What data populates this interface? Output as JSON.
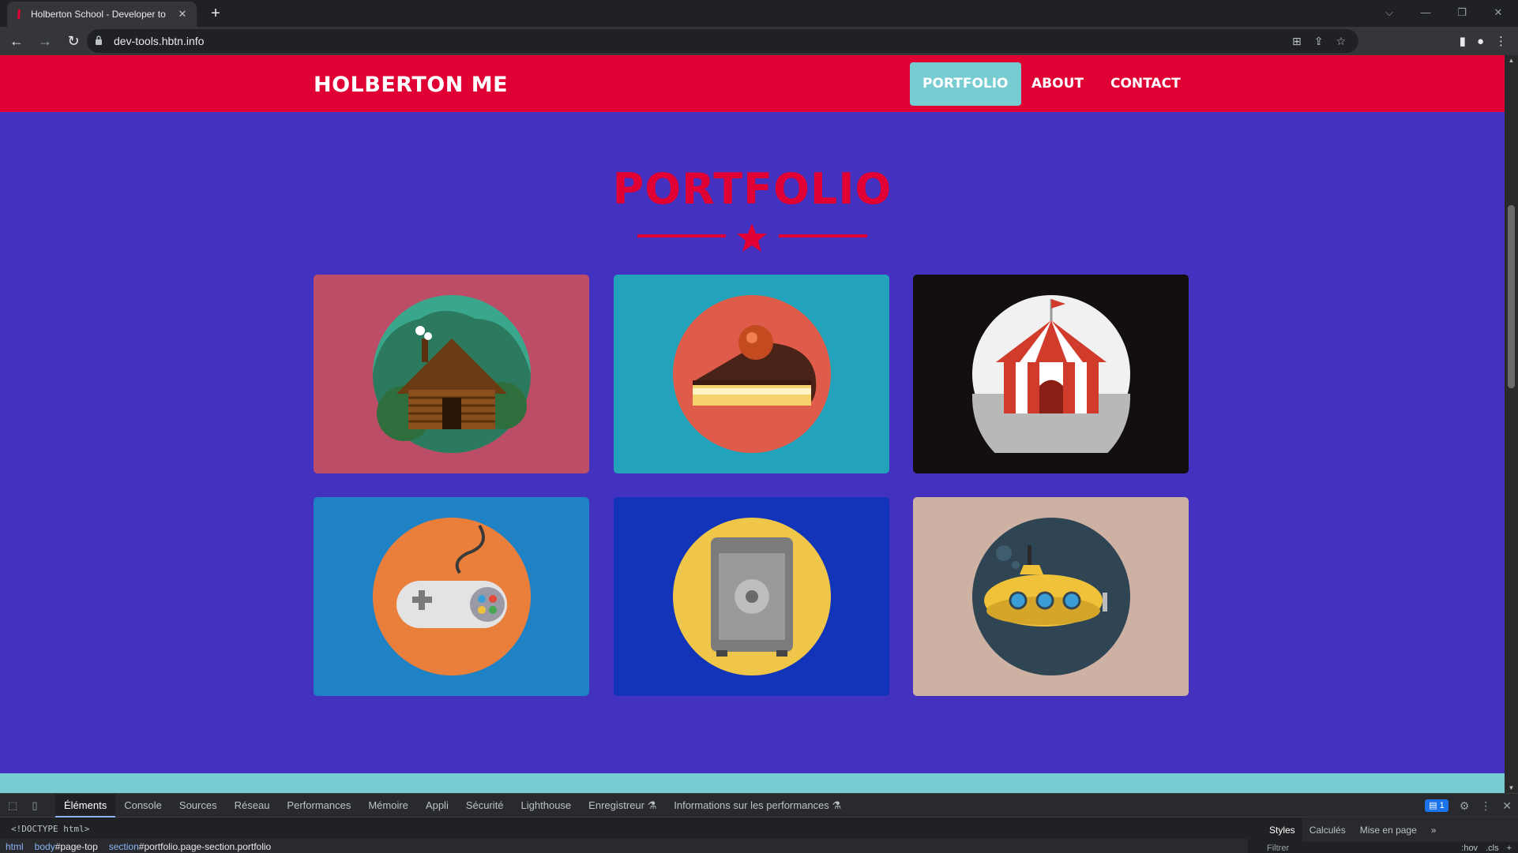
{
  "browser": {
    "tab_title": "Holberton School - Developer to",
    "tab_close": "✕",
    "new_tab": "+",
    "url": "dev-tools.hbtn.info"
  },
  "site": {
    "brand": "HOLBERTON ME",
    "nav": [
      {
        "label": "PORTFOLIO",
        "active": true
      },
      {
        "label": "ABOUT",
        "active": false
      },
      {
        "label": "CONTACT",
        "active": false
      }
    ],
    "section_title": "PORTFOLIO",
    "colors": {
      "primary_red": "#e00034",
      "background_purple": "#4331bf",
      "accent_teal": "#76ccd1"
    },
    "portfolio": [
      {
        "name": "cabin",
        "bg": "#bb4e66"
      },
      {
        "name": "cake",
        "bg": "#22a3bb"
      },
      {
        "name": "circus",
        "bg": "#130f0e"
      },
      {
        "name": "game",
        "bg": "#1f82c4"
      },
      {
        "name": "safe",
        "bg": "#1134b8"
      },
      {
        "name": "submarine",
        "bg": "#cdb1a2"
      }
    ]
  },
  "devtools": {
    "tabs": [
      "Éléments",
      "Console",
      "Sources",
      "Réseau",
      "Performances",
      "Mémoire",
      "Appli",
      "Sécurité",
      "Lighthouse",
      "Enregistreur ⚗",
      "Informations sur les performances ⚗"
    ],
    "active_tab": "Éléments",
    "issues_count": "1",
    "dom_line": "<!DOCTYPE html>",
    "breadcrumbs": [
      {
        "tag": "html",
        "rest": ""
      },
      {
        "tag": "body",
        "rest": "#page-top"
      },
      {
        "tag": "section",
        "rest": "#portfolio.page-section.portfolio"
      }
    ],
    "side_tabs": [
      "Styles",
      "Calculés",
      "Mise en page",
      "»"
    ],
    "filter_placeholder": "Filtrer",
    "filter_buttons": [
      ":hov",
      ".cls",
      "+"
    ]
  }
}
